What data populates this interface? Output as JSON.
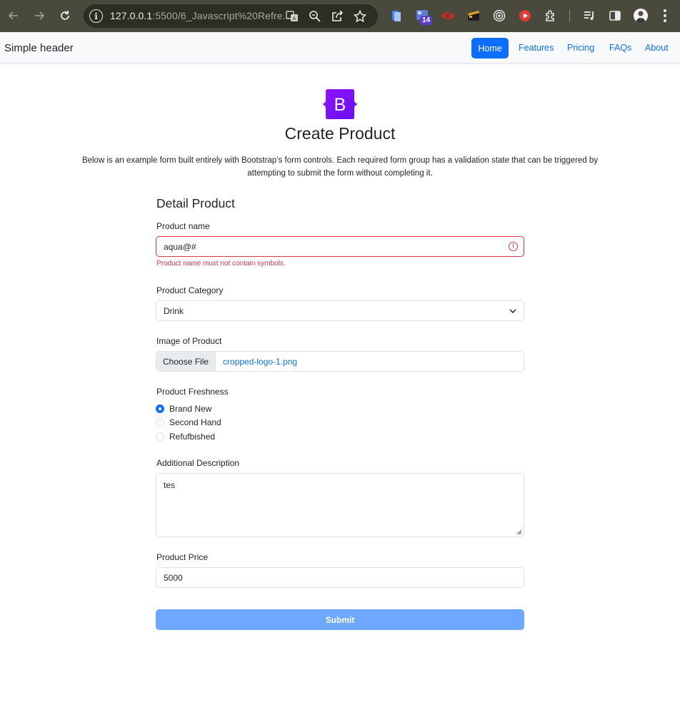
{
  "browser": {
    "url_host": "127.0.0.1",
    "url_rest": ":5500/6_Javascript%20Refre...",
    "extension_badge": "14"
  },
  "header": {
    "brand": "Simple header",
    "nav": [
      {
        "label": "Home",
        "active": true
      },
      {
        "label": "Features",
        "active": false
      },
      {
        "label": "Pricing",
        "active": false
      },
      {
        "label": "FAQs",
        "active": false
      },
      {
        "label": "About",
        "active": false
      }
    ]
  },
  "hero": {
    "logo_letter": "B",
    "logo_color": "#7952b3",
    "title": "Create Product",
    "lead": "Below is an example form built entirely with Bootstrap’s form controls. Each required form group has a validation state that can be triggered by attempting to submit the form without completing it."
  },
  "form": {
    "section_title": "Detail Product",
    "product_name": {
      "label": "Product name",
      "value": "aqua@#",
      "error": "Product name must not contain symbols."
    },
    "category": {
      "label": "Product Category",
      "value": "Drink"
    },
    "image": {
      "label": "Image of Product",
      "button": "Choose File",
      "file_name": "cropped-logo-1.png"
    },
    "freshness": {
      "label": "Product Freshness",
      "options": [
        {
          "label": "Brand New",
          "checked": true
        },
        {
          "label": "Second Hand",
          "checked": false
        },
        {
          "label": "Refufbished",
          "checked": false
        }
      ]
    },
    "description": {
      "label": "Additional Description",
      "value": "tes"
    },
    "price": {
      "label": "Product Price",
      "value": "5000"
    },
    "submit_label": "Submit"
  },
  "colors": {
    "primary": "#0d6efd",
    "danger": "#dc3545",
    "submit_disabled": "#6ea8fe"
  }
}
